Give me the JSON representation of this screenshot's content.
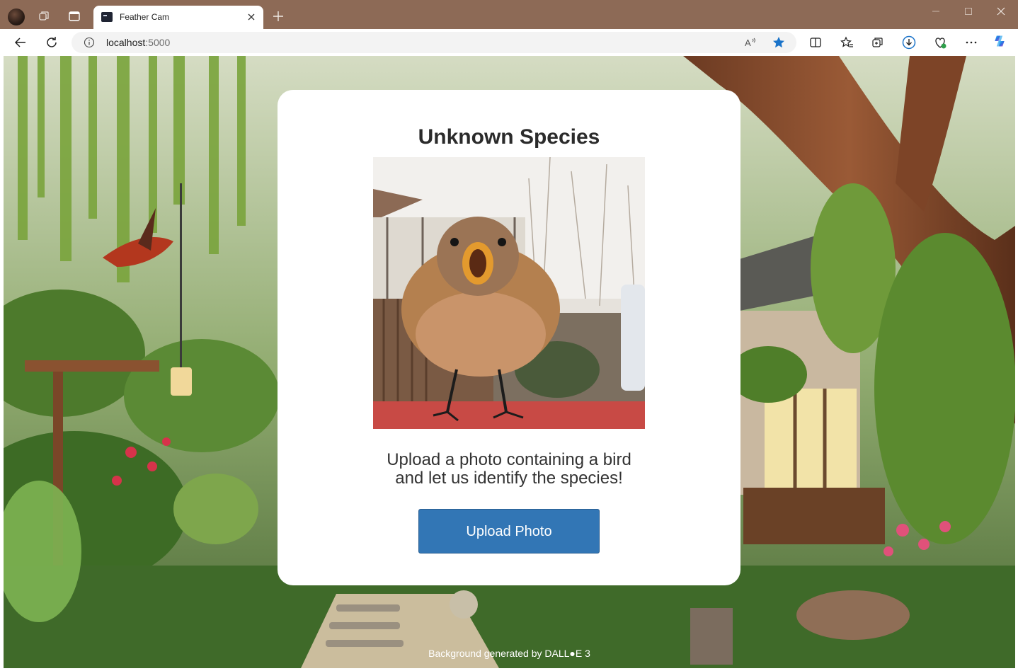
{
  "browser": {
    "tab_title": "Feather Cam",
    "url_host": "localhost",
    "url_port": ":5000",
    "icons": [
      "profile-avatar",
      "workspaces-icon",
      "vertical-tabs-icon",
      "new-tab-icon",
      "back-icon",
      "refresh-icon",
      "info-icon",
      "read-aloud-icon",
      "favorite-star-icon",
      "split-screen-icon",
      "favorites-icon",
      "collections-icon",
      "downloads-icon",
      "browser-essentials-icon",
      "more-icon",
      "copilot-icon",
      "minimize-icon",
      "maximize-icon",
      "close-icon"
    ]
  },
  "card": {
    "title": "Unknown Species",
    "text_line1": "Upload a photo containing a bird",
    "text_line2": "and let us identify the species!",
    "upload_button": "Upload Photo"
  },
  "footer": {
    "credit": "Background generated by DALL●E 3"
  },
  "colors": {
    "titlebar": "#8d6a56",
    "accent_button": "#3276b5",
    "favorite_star": "#1a73c9"
  }
}
